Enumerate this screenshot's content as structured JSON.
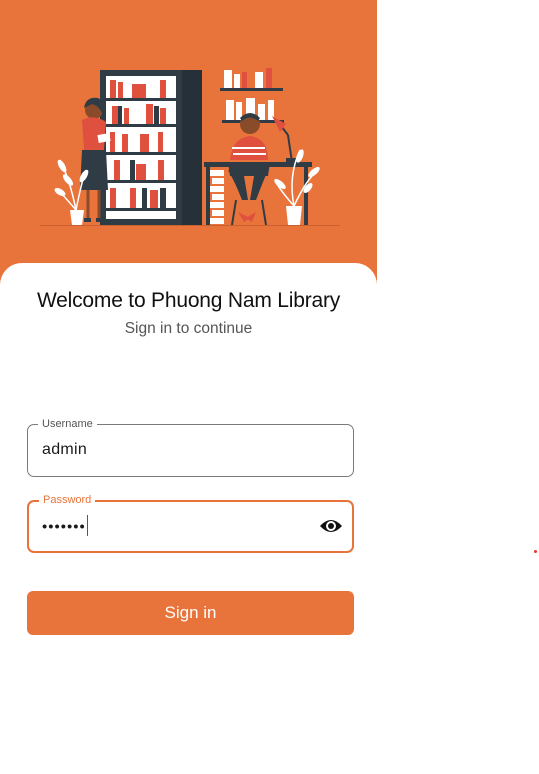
{
  "colors": {
    "accent": "#e8743b",
    "hero_bg": "#e8743b"
  },
  "hero": {
    "illustration": "library-reading-illustration"
  },
  "login": {
    "title": "Welcome to Phuong Nam Library",
    "subtitle": "Sign in to continue",
    "username": {
      "label": "Username",
      "value": "admin"
    },
    "password": {
      "label": "Password",
      "masked_value": "•••••••",
      "visibility_icon": "eye-icon"
    },
    "signin_label": "Sign in"
  }
}
